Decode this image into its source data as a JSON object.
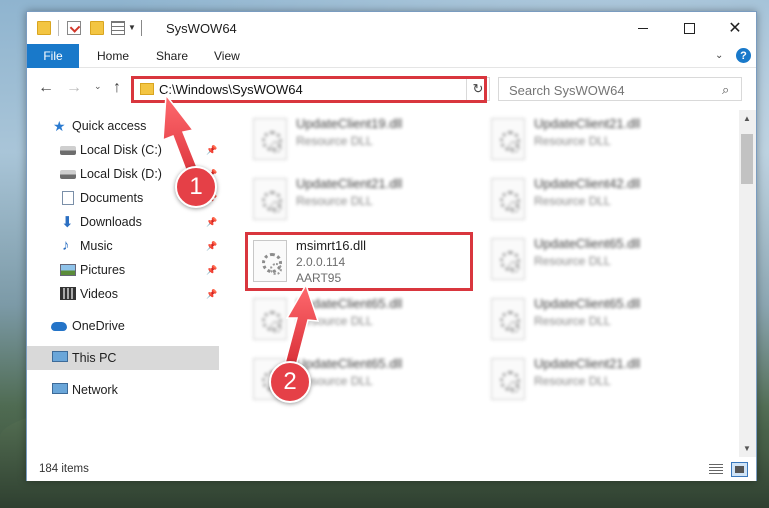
{
  "window": {
    "title": "SysWOW64",
    "buttons": {
      "minimize": "",
      "maximize": "",
      "close": "✕"
    }
  },
  "ribbon": {
    "tabs": [
      {
        "label": "File",
        "active": true
      },
      {
        "label": "Home"
      },
      {
        "label": "Share"
      },
      {
        "label": "View"
      }
    ],
    "help": "?"
  },
  "navigation": {
    "back": "←",
    "forward": "→",
    "recent": "⌄",
    "up": "↑",
    "address": "C:\\Windows\\SysWOW64",
    "address_dropdown": "⌄",
    "refresh": "↻",
    "search_placeholder": "Search SysWOW64"
  },
  "sidebar": {
    "items": [
      {
        "label": "Quick access",
        "icon": "star-icon",
        "pinned": false
      },
      {
        "label": "Local Disk (C:)",
        "icon": "drive-icon",
        "pinned": true
      },
      {
        "label": "Local Disk (D:)",
        "icon": "drive-icon",
        "pinned": true
      },
      {
        "label": "Documents",
        "icon": "documents-icon",
        "pinned": true
      },
      {
        "label": "Downloads",
        "icon": "download-icon",
        "pinned": true
      },
      {
        "label": "Music",
        "icon": "music-icon",
        "pinned": true
      },
      {
        "label": "Pictures",
        "icon": "pictures-icon",
        "pinned": true
      },
      {
        "label": "Videos",
        "icon": "videos-icon",
        "pinned": true
      },
      {
        "label": "OneDrive",
        "icon": "cloud-icon"
      },
      {
        "label": "This PC",
        "icon": "computer-icon",
        "selected": true
      },
      {
        "label": "Network",
        "icon": "network-icon"
      }
    ]
  },
  "files": [
    {
      "name": "UpdateClient19.dll",
      "line2": "Resource DLL",
      "blurred": true
    },
    {
      "name": "UpdateClient21.dll",
      "line2": "Resource DLL",
      "blurred": true
    },
    {
      "name": "UpdateClient21.dll",
      "line2": "Resource DLL",
      "blurred": true
    },
    {
      "name": "UpdateClient42.dll",
      "line2": "Resource DLL",
      "blurred": true
    },
    {
      "name": "msimrt16.dll",
      "line2": "2.0.0.114",
      "line3": "AART95",
      "blurred": false,
      "highlighted": true
    },
    {
      "name": "UpdateClient65.dll",
      "line2": "Resource DLL",
      "blurred": true
    },
    {
      "name": "UpdateClient65.dll",
      "line2": "Resource DLL",
      "blurred": true
    },
    {
      "name": "UpdateClient65.dll",
      "line2": "Resource DLL",
      "blurred": true
    },
    {
      "name": "UpdateClient65.dll",
      "line2": "Resource DLL",
      "blurred": true
    },
    {
      "name": "UpdateClient21.dll",
      "line2": "Resource DLL",
      "blurred": true
    }
  ],
  "status": {
    "item_count": "184 items"
  },
  "annotations": {
    "step1": "1",
    "step2": "2",
    "color": "#e54047"
  }
}
